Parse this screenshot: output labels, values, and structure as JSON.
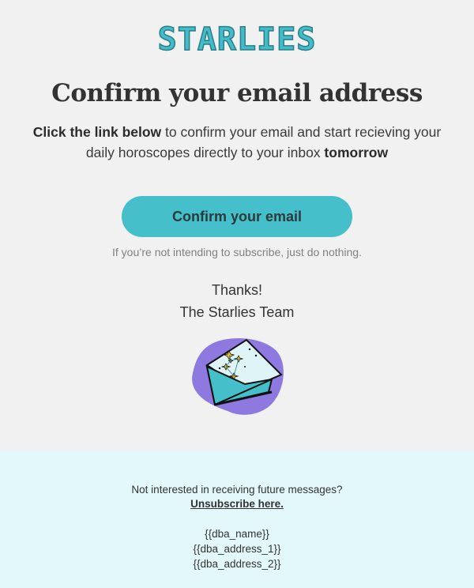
{
  "brand": {
    "logo_text": "STARLIES",
    "logo_color": "#43bcc9"
  },
  "main": {
    "title": "Confirm your email address",
    "body_bold_1": "Click the link below",
    "body_mid": " to confirm your email and start recieving your daily horoscopes directly to your inbox ",
    "body_bold_2": "tomorrow",
    "confirm_button_label": "Confirm your email",
    "fine_print": "If you’re not intending to subscribe, just do nothing.",
    "thanks_line_1": "Thanks!",
    "thanks_line_2": "The Starlies Team",
    "illustration_icon": "envelope-constellation-icon",
    "accent_color": "#45bfc9",
    "blob_color": "#8e79e0"
  },
  "footer": {
    "message": "Not interested in receiving future messages?",
    "unsubscribe_label": "Unsubscribe here.",
    "address_lines": [
      "{{dba_name}}",
      "{{dba_address_1}}",
      "{{dba_address_2}}"
    ],
    "background": "#e2f8fa"
  }
}
